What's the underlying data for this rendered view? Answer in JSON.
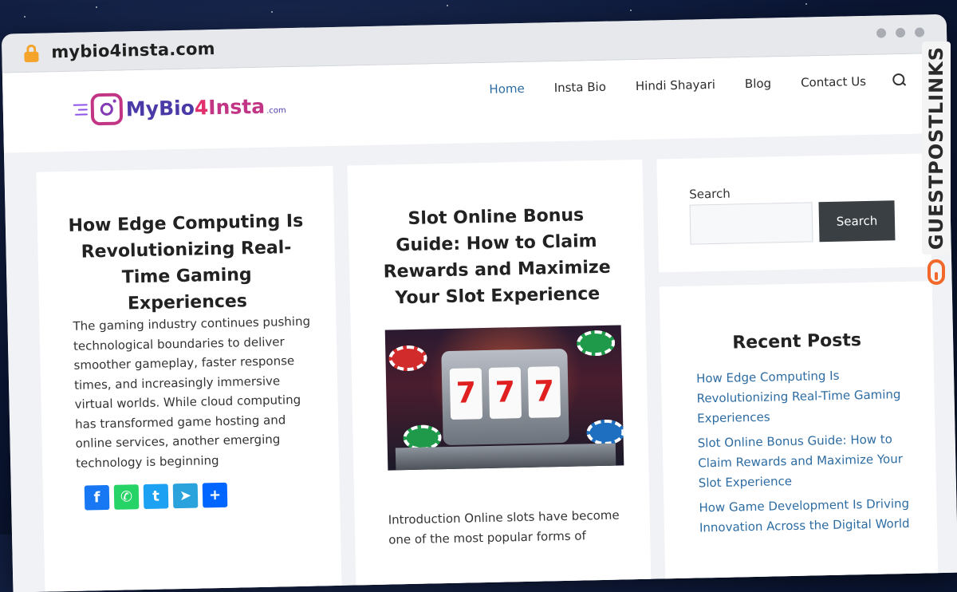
{
  "browser": {
    "url": "mybio4insta.com"
  },
  "logo": {
    "part1": "MyBio",
    "part2": "4",
    "part3": "Insta",
    "tld": ".com"
  },
  "nav": {
    "items": [
      {
        "label": "Home",
        "active": true
      },
      {
        "label": "Insta Bio",
        "active": false
      },
      {
        "label": "Hindi Shayari",
        "active": false
      },
      {
        "label": "Blog",
        "active": false
      },
      {
        "label": "Contact Us",
        "active": false
      }
    ]
  },
  "posts": [
    {
      "title": "How Edge Computing Is Revolutionizing Real-Time Gaming Experiences",
      "excerpt": "The gaming industry continues pushing technological boundaries to deliver smoother gameplay, faster response times, and increasingly immersive virtual worlds. While cloud computing has transformed game hosting and online services, another emerging technology is beginning"
    },
    {
      "title": "Slot Online Bonus Guide: How to Claim Rewards and Maximize Your Slot Experience",
      "excerpt": "Introduction Online slots have become one of the most popular forms of",
      "reel_symbol": "7"
    }
  ],
  "share": {
    "facebook": "f",
    "whatsapp": "✆",
    "twitter": "t",
    "telegram": "➤",
    "more": "+"
  },
  "sidebar": {
    "search_label": "Search",
    "search_button": "Search",
    "recent_title": "Recent Posts",
    "recent": [
      "How Edge Computing Is Revolutionizing Real-Time Gaming Experiences",
      "Slot Online Bonus Guide: How to Claim Rewards and Maximize Your Slot Experience",
      "How Game Development Is Driving Innovation Across the Digital World"
    ]
  },
  "watermark": {
    "text": "GUESTPOSTLINKS"
  },
  "colors": {
    "link": "#2d6ca2",
    "accent_orange": "#f2682a",
    "button_dark": "#3a3f44"
  }
}
